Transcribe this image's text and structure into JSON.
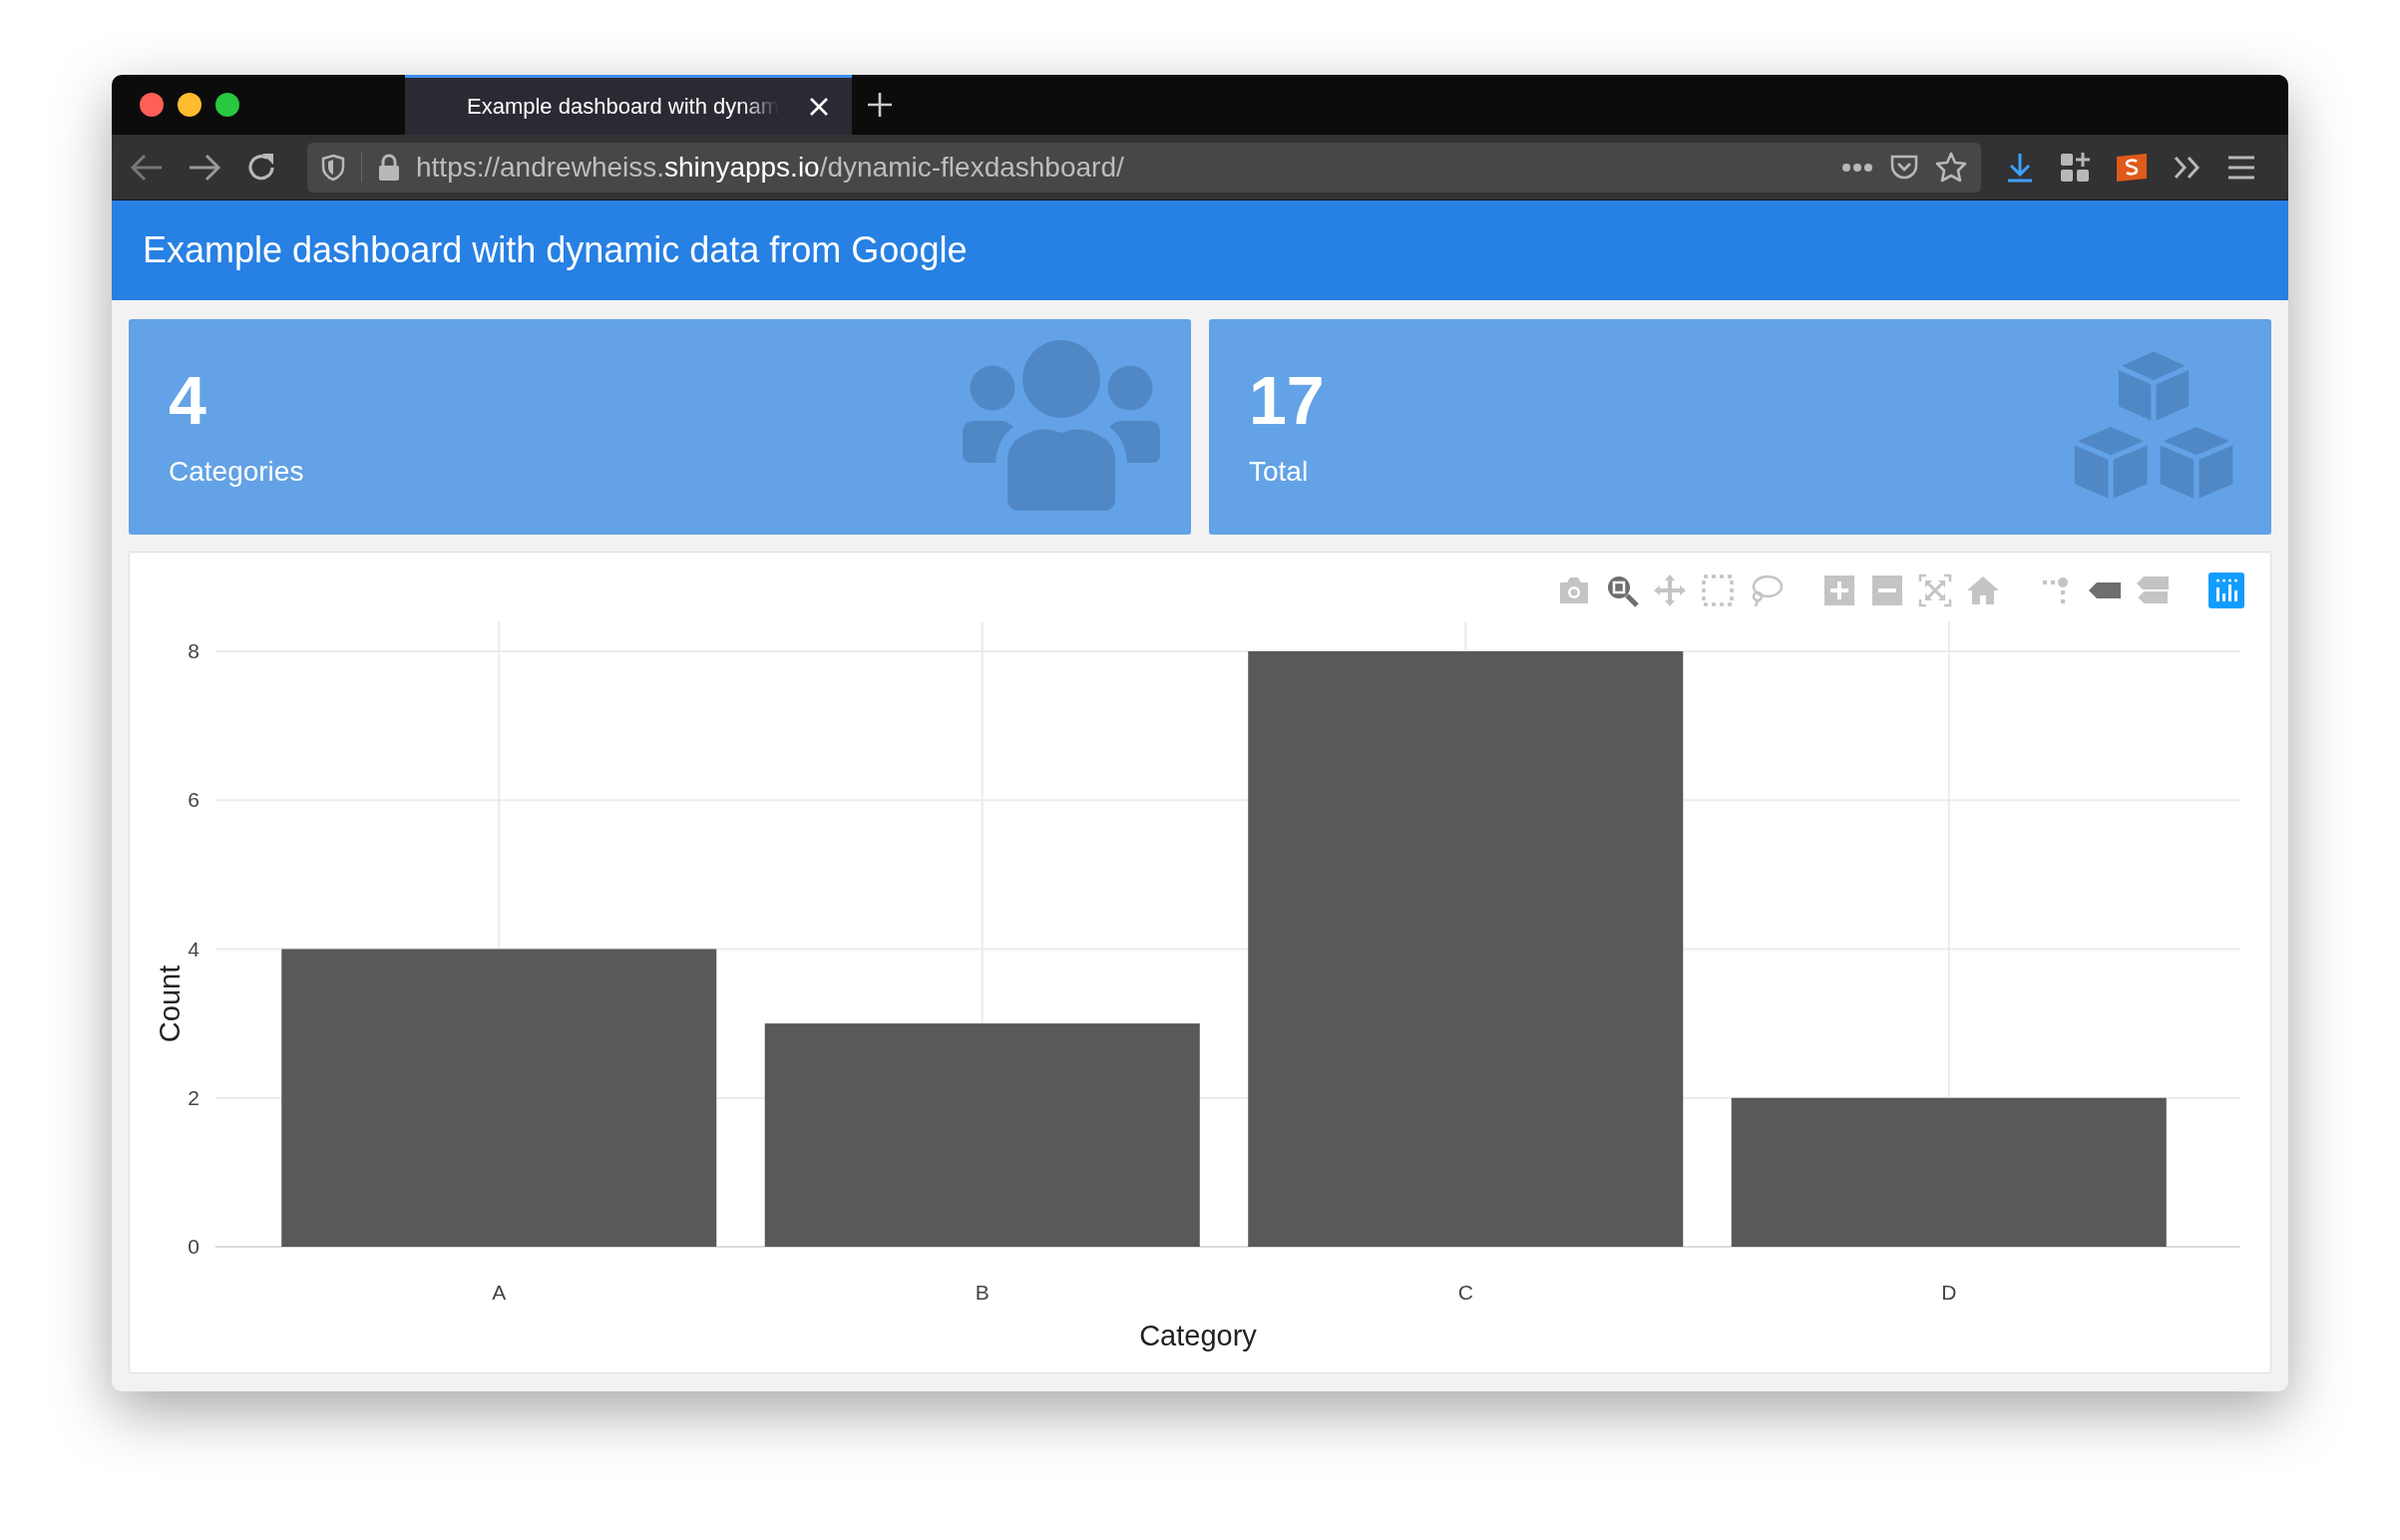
{
  "browser": {
    "tabs": [
      {
        "title": "Example dashboard with dynam",
        "selected": true
      }
    ],
    "address": {
      "prefix": "https://andrewheiss.",
      "host": "shinyapps.io",
      "suffix": "/dynamic-flexdashboard/"
    }
  },
  "header": {
    "title": "Example dashboard with dynamic data from Google"
  },
  "value_boxes": [
    {
      "kind": "users",
      "value": "4",
      "caption": "Categories"
    },
    {
      "kind": "cubes",
      "value": "17",
      "caption": "Total"
    }
  ],
  "chart": {
    "modebar": [
      {
        "kind": "camera",
        "selected": false
      },
      {
        "kind": "zoom",
        "selected": true
      },
      {
        "kind": "pan",
        "selected": false
      },
      {
        "kind": "box",
        "selected": false
      },
      {
        "kind": "lasso",
        "selected": false
      },
      {
        "kind": "zoomin",
        "selected": false
      },
      {
        "kind": "zoomout",
        "selected": false
      },
      {
        "kind": "autoscale",
        "selected": false
      },
      {
        "kind": "home",
        "selected": false
      },
      {
        "kind": "spike",
        "selected": false
      },
      {
        "kind": "closest",
        "selected": true
      },
      {
        "kind": "compare",
        "selected": false
      },
      {
        "kind": "logo"
      }
    ],
    "chart_data": {
      "type": "bar",
      "xlabel": "Category",
      "ylabel": "Count",
      "categories": [
        "A",
        "B",
        "C",
        "D"
      ],
      "series": [
        {
          "color": "#595959",
          "values": [
            4,
            3,
            8,
            2
          ]
        }
      ],
      "grid": true,
      "ylim": [
        0,
        8
      ],
      "yticks": [
        0,
        2,
        4,
        6,
        8
      ]
    }
  }
}
